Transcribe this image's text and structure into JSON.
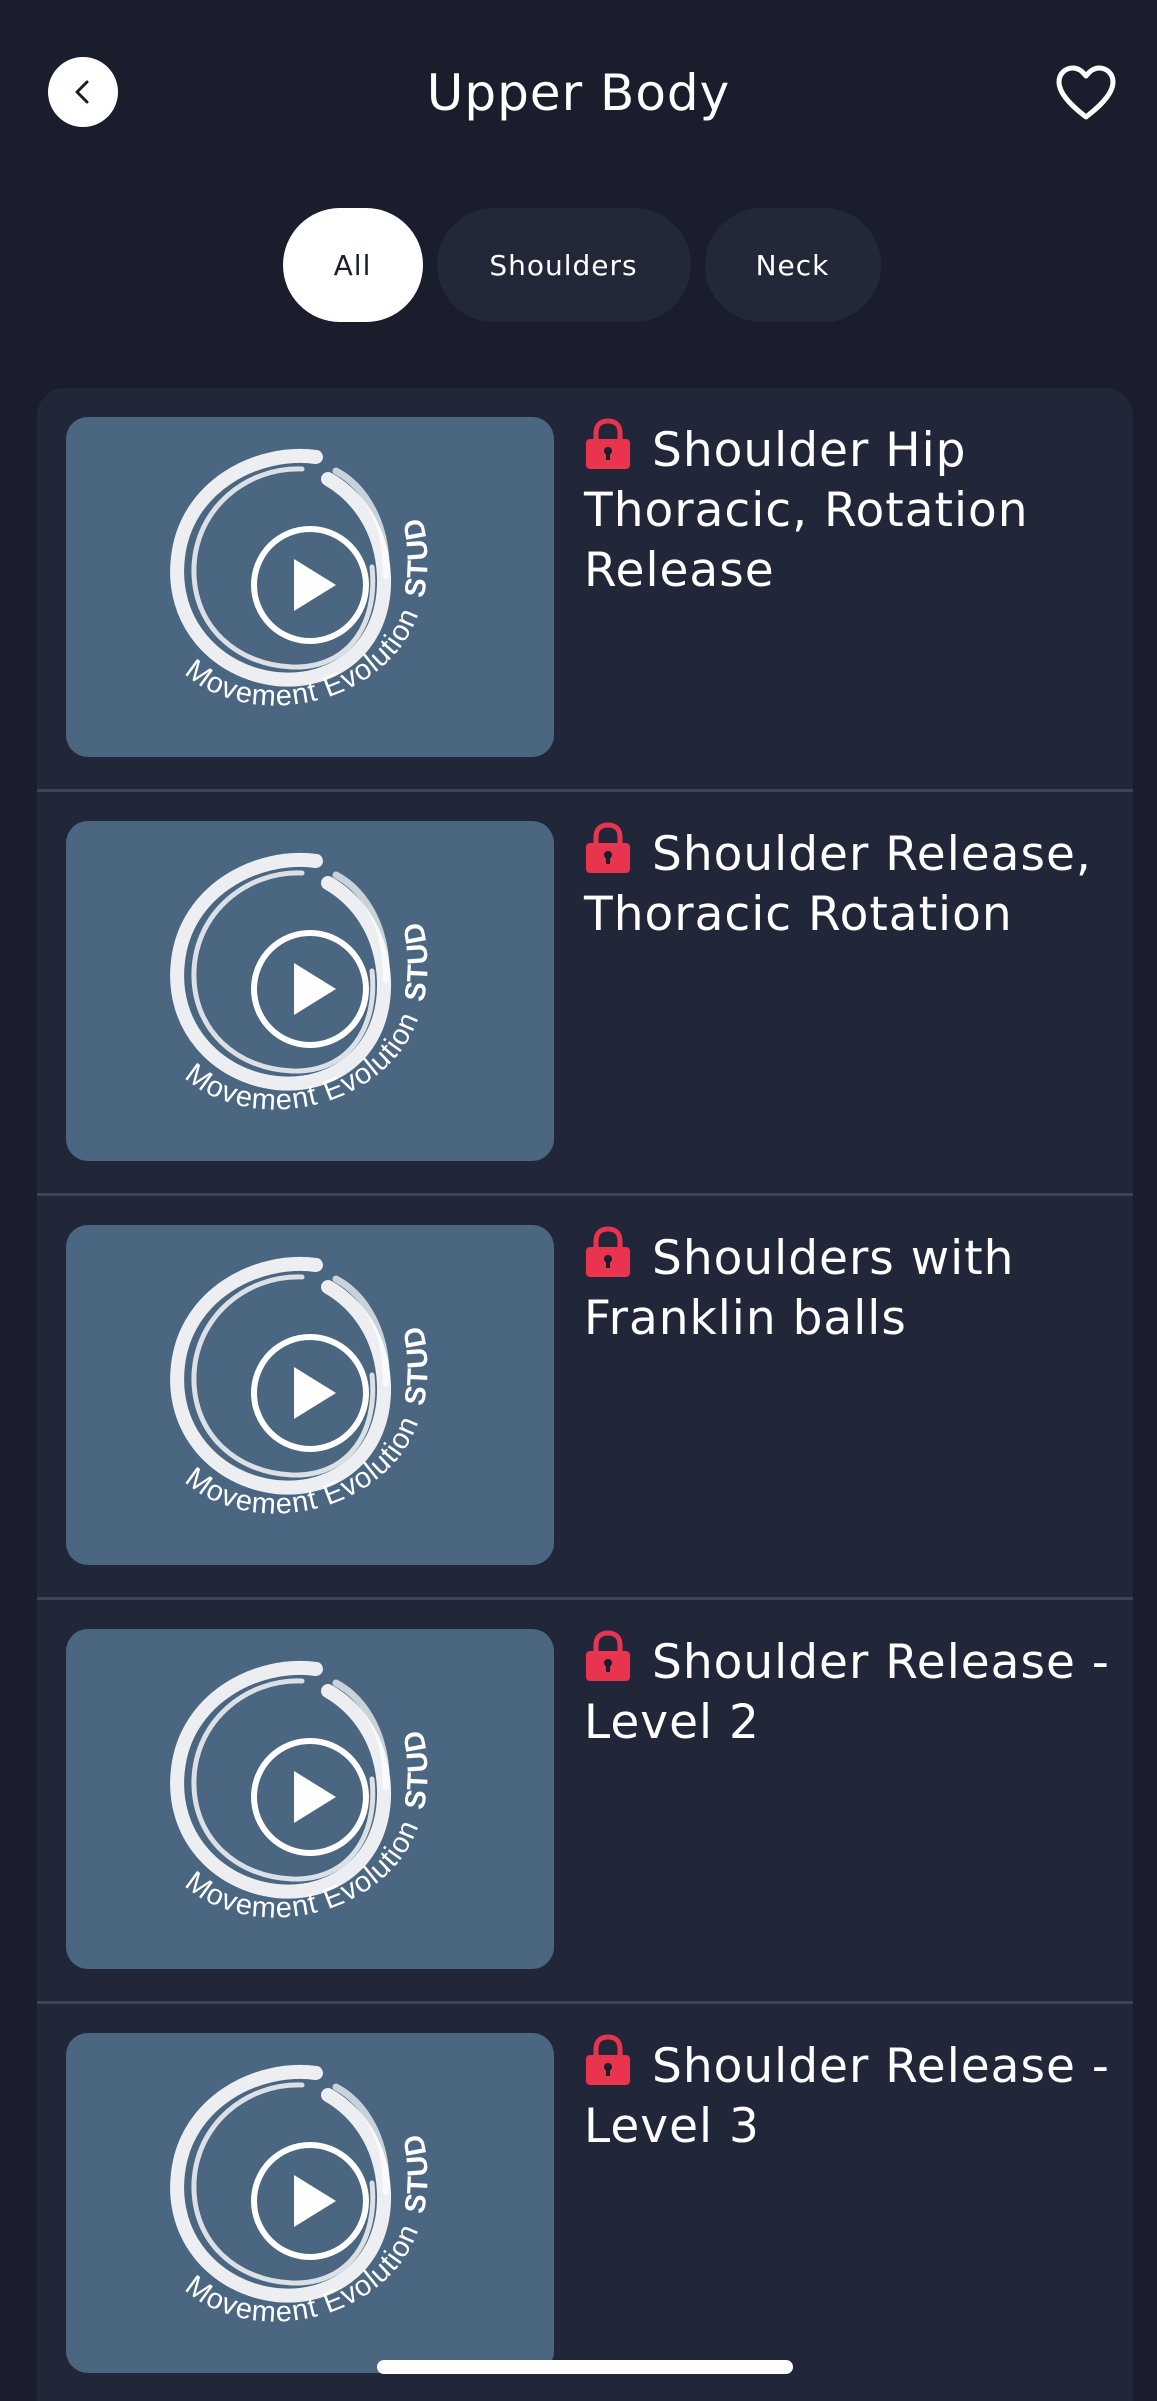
{
  "header": {
    "title": "Upper Body",
    "back_icon": "chevron-left-icon",
    "favorite_icon": "heart-outline-icon"
  },
  "filters": [
    {
      "label": "All",
      "active": true
    },
    {
      "label": "Shoulders",
      "active": false
    },
    {
      "label": "Neck",
      "active": false
    }
  ],
  "thumbnail": {
    "logo_text": "Movement Evolution",
    "logo_text_bold": "STUDIO",
    "play_icon": "play-icon"
  },
  "videos": [
    {
      "title": "Shoulder Hip Thoracic, Rotation Release",
      "locked": true
    },
    {
      "title": "Shoulder Release, Thoracic Rotation",
      "locked": true
    },
    {
      "title": "Shoulders with Franklin balls",
      "locked": true
    },
    {
      "title": "Shoulder Release - Level 2",
      "locked": true
    },
    {
      "title": "Shoulder Release - Level 3",
      "locked": true
    }
  ],
  "colors": {
    "background": "#1a1e2c",
    "card": "#222639",
    "thumbnail": "#4a6680",
    "lock": "#e8344e",
    "chip_inactive": "#232839",
    "chip_active": "#ffffff"
  }
}
